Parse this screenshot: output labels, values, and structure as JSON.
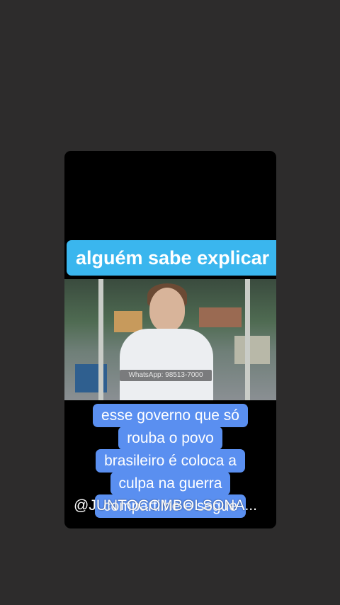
{
  "post": {
    "top_banner": "alguém  sabe explicar",
    "video_lower_third": "WhatsApp: 98513-7000",
    "caption_lines": [
      "esse governo  que só",
      "rouba  o povo",
      "brasileiro  é coloca a",
      "culpa  na guerra",
      "compartilhe e  segue"
    ],
    "handle": "@JUNTOCOMBOLSONA..."
  },
  "colors": {
    "background": "#2d2c2c",
    "banner": "#3ab6ee",
    "caption": "#5a8ff0"
  }
}
